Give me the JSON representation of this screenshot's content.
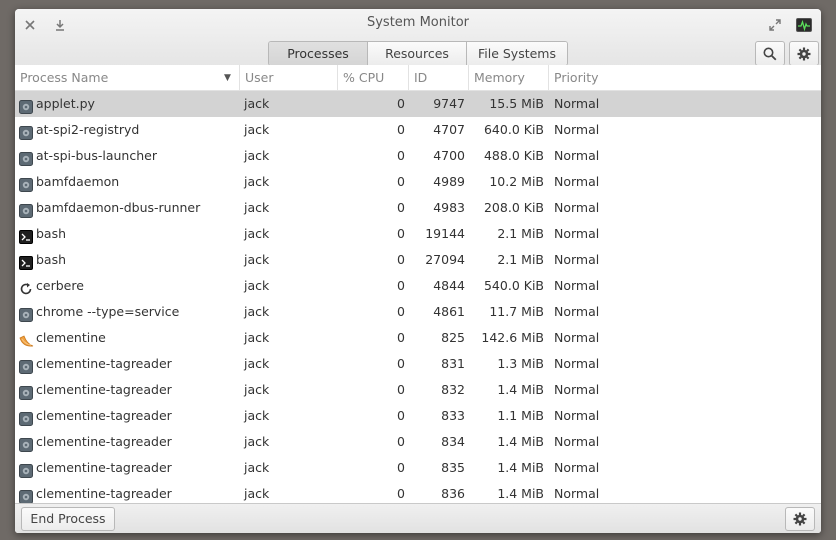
{
  "window": {
    "title": "System Monitor"
  },
  "tabs": [
    {
      "label": "Processes",
      "active": true
    },
    {
      "label": "Resources",
      "active": false
    },
    {
      "label": "File Systems",
      "active": false
    }
  ],
  "columns": {
    "name": "Process Name",
    "user": "User",
    "cpu": "% CPU",
    "id": "ID",
    "memory": "Memory",
    "priority": "Priority"
  },
  "processes": [
    {
      "icon": "gear-icon",
      "name": "applet.py",
      "user": "jack",
      "cpu": "0",
      "id": "9747",
      "memory": "15.5 MiB",
      "priority": "Normal",
      "selected": true
    },
    {
      "icon": "gear-icon",
      "name": "at-spi2-registryd",
      "user": "jack",
      "cpu": "0",
      "id": "4707",
      "memory": "640.0 KiB",
      "priority": "Normal"
    },
    {
      "icon": "gear-icon",
      "name": "at-spi-bus-launcher",
      "user": "jack",
      "cpu": "0",
      "id": "4700",
      "memory": "488.0 KiB",
      "priority": "Normal"
    },
    {
      "icon": "gear-icon",
      "name": "bamfdaemon",
      "user": "jack",
      "cpu": "0",
      "id": "4989",
      "memory": "10.2 MiB",
      "priority": "Normal"
    },
    {
      "icon": "gear-icon",
      "name": "bamfdaemon-dbus-runner",
      "user": "jack",
      "cpu": "0",
      "id": "4983",
      "memory": "208.0 KiB",
      "priority": "Normal"
    },
    {
      "icon": "terminal-icon",
      "name": "bash",
      "user": "jack",
      "cpu": "0",
      "id": "19144",
      "memory": "2.1 MiB",
      "priority": "Normal"
    },
    {
      "icon": "terminal-icon",
      "name": "bash",
      "user": "jack",
      "cpu": "0",
      "id": "27094",
      "memory": "2.1 MiB",
      "priority": "Normal"
    },
    {
      "icon": "refresh-icon",
      "name": "cerbere",
      "user": "jack",
      "cpu": "0",
      "id": "4844",
      "memory": "540.0 KiB",
      "priority": "Normal"
    },
    {
      "icon": "gear-icon",
      "name": "chrome --type=service",
      "user": "jack",
      "cpu": "0",
      "id": "4861",
      "memory": "11.7 MiB",
      "priority": "Normal"
    },
    {
      "icon": "tangerine-icon",
      "name": "clementine",
      "user": "jack",
      "cpu": "0",
      "id": "825",
      "memory": "142.6 MiB",
      "priority": "Normal"
    },
    {
      "icon": "gear-icon",
      "name": "clementine-tagreader",
      "user": "jack",
      "cpu": "0",
      "id": "831",
      "memory": "1.3 MiB",
      "priority": "Normal"
    },
    {
      "icon": "gear-icon",
      "name": "clementine-tagreader",
      "user": "jack",
      "cpu": "0",
      "id": "832",
      "memory": "1.4 MiB",
      "priority": "Normal"
    },
    {
      "icon": "gear-icon",
      "name": "clementine-tagreader",
      "user": "jack",
      "cpu": "0",
      "id": "833",
      "memory": "1.1 MiB",
      "priority": "Normal"
    },
    {
      "icon": "gear-icon",
      "name": "clementine-tagreader",
      "user": "jack",
      "cpu": "0",
      "id": "834",
      "memory": "1.4 MiB",
      "priority": "Normal"
    },
    {
      "icon": "gear-icon",
      "name": "clementine-tagreader",
      "user": "jack",
      "cpu": "0",
      "id": "835",
      "memory": "1.4 MiB",
      "priority": "Normal"
    },
    {
      "icon": "gear-icon",
      "name": "clementine-tagreader",
      "user": "jack",
      "cpu": "0",
      "id": "836",
      "memory": "1.4 MiB",
      "priority": "Normal"
    }
  ],
  "footer": {
    "end_process_label": "End Process"
  }
}
